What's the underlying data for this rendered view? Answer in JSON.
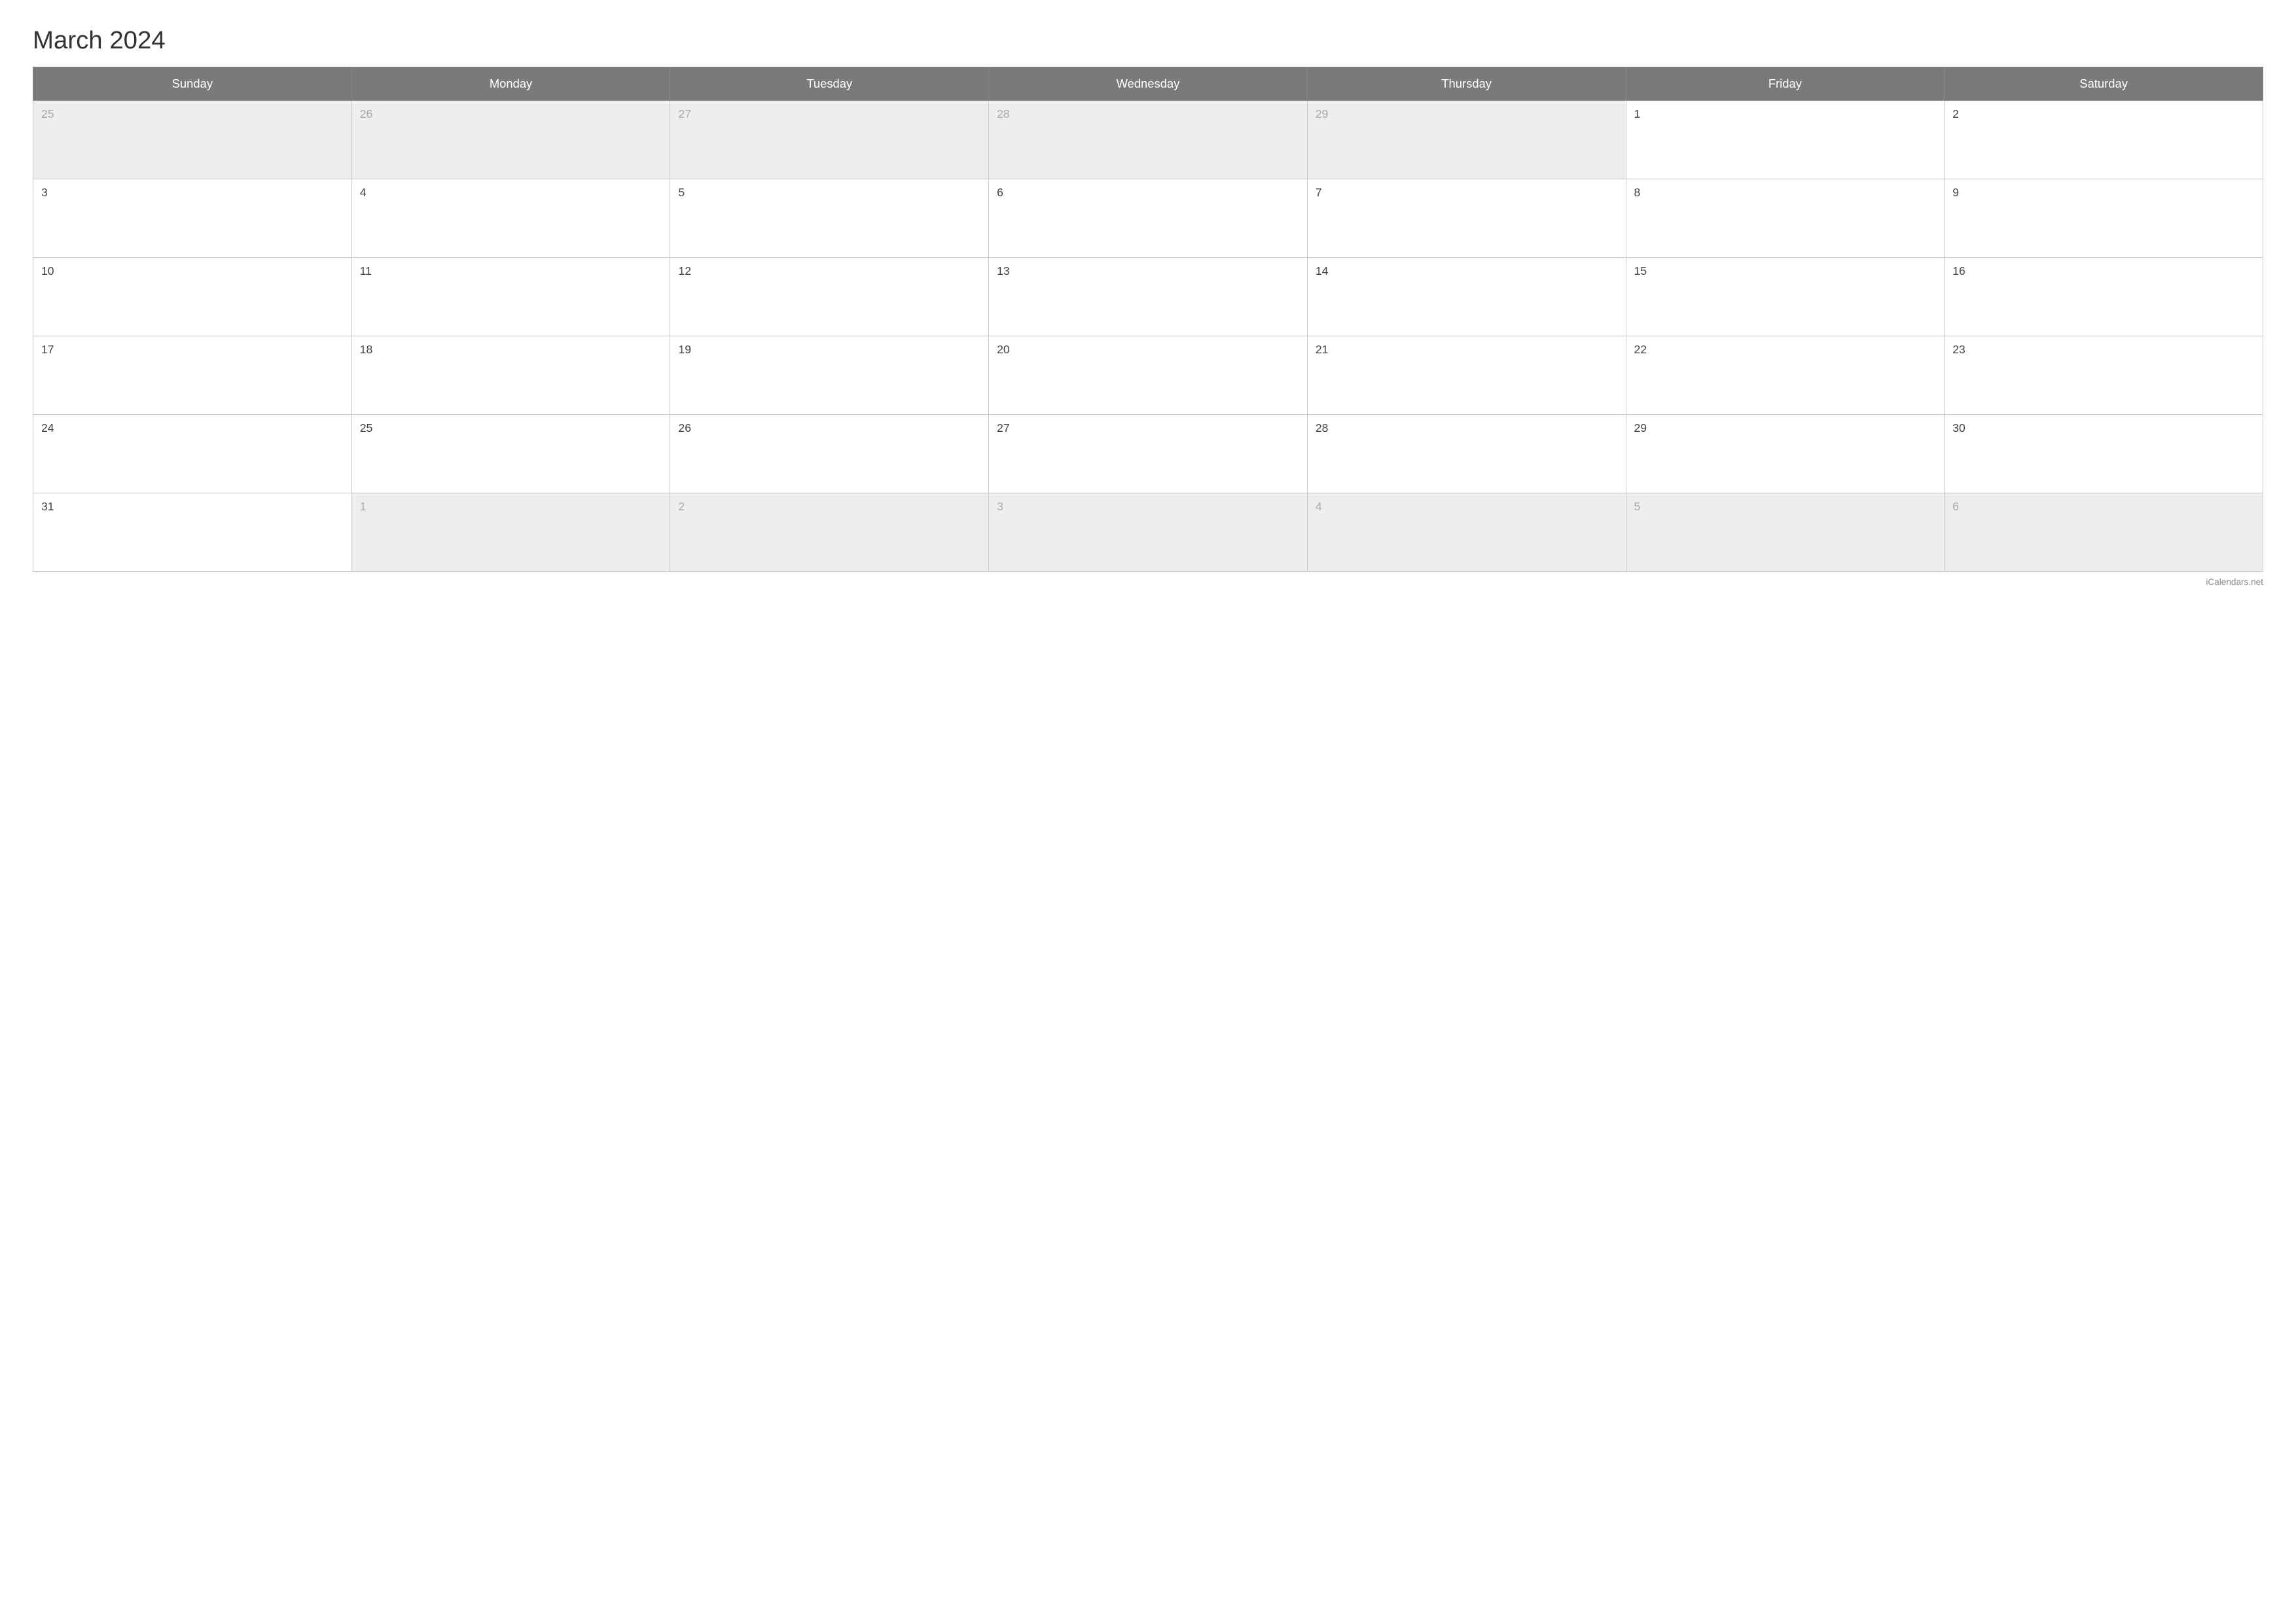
{
  "title": "March 2024",
  "header": {
    "days": [
      "Sunday",
      "Monday",
      "Tuesday",
      "Wednesday",
      "Thursday",
      "Friday",
      "Saturday"
    ]
  },
  "weeks": [
    [
      {
        "date": "25",
        "otherMonth": true
      },
      {
        "date": "26",
        "otherMonth": true
      },
      {
        "date": "27",
        "otherMonth": true
      },
      {
        "date": "28",
        "otherMonth": true
      },
      {
        "date": "29",
        "otherMonth": true
      },
      {
        "date": "1",
        "otherMonth": false
      },
      {
        "date": "2",
        "otherMonth": false
      }
    ],
    [
      {
        "date": "3",
        "otherMonth": false
      },
      {
        "date": "4",
        "otherMonth": false
      },
      {
        "date": "5",
        "otherMonth": false
      },
      {
        "date": "6",
        "otherMonth": false
      },
      {
        "date": "7",
        "otherMonth": false
      },
      {
        "date": "8",
        "otherMonth": false
      },
      {
        "date": "9",
        "otherMonth": false
      }
    ],
    [
      {
        "date": "10",
        "otherMonth": false
      },
      {
        "date": "11",
        "otherMonth": false
      },
      {
        "date": "12",
        "otherMonth": false
      },
      {
        "date": "13",
        "otherMonth": false
      },
      {
        "date": "14",
        "otherMonth": false
      },
      {
        "date": "15",
        "otherMonth": false
      },
      {
        "date": "16",
        "otherMonth": false
      }
    ],
    [
      {
        "date": "17",
        "otherMonth": false
      },
      {
        "date": "18",
        "otherMonth": false
      },
      {
        "date": "19",
        "otherMonth": false
      },
      {
        "date": "20",
        "otherMonth": false
      },
      {
        "date": "21",
        "otherMonth": false
      },
      {
        "date": "22",
        "otherMonth": false
      },
      {
        "date": "23",
        "otherMonth": false
      }
    ],
    [
      {
        "date": "24",
        "otherMonth": false
      },
      {
        "date": "25",
        "otherMonth": false
      },
      {
        "date": "26",
        "otherMonth": false
      },
      {
        "date": "27",
        "otherMonth": false
      },
      {
        "date": "28",
        "otherMonth": false
      },
      {
        "date": "29",
        "otherMonth": false
      },
      {
        "date": "30",
        "otherMonth": false
      }
    ],
    [
      {
        "date": "31",
        "otherMonth": false
      },
      {
        "date": "1",
        "otherMonth": true
      },
      {
        "date": "2",
        "otherMonth": true
      },
      {
        "date": "3",
        "otherMonth": true
      },
      {
        "date": "4",
        "otherMonth": true
      },
      {
        "date": "5",
        "otherMonth": true
      },
      {
        "date": "6",
        "otherMonth": true
      }
    ]
  ],
  "footer": {
    "credit": "iCalendars.net"
  }
}
